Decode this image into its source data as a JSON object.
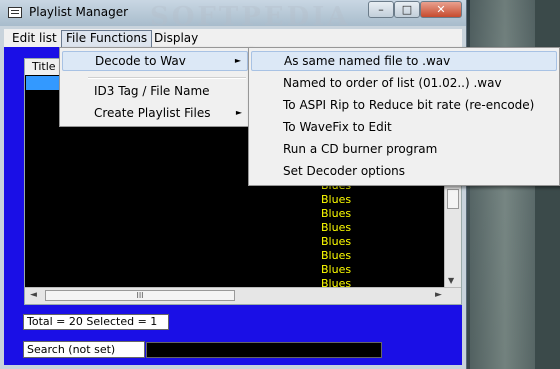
{
  "window": {
    "title": "Playlist Manager",
    "watermark": "SOFTPEDIA",
    "controls": {
      "minimize": "–",
      "maximize": "□",
      "close": "✕"
    }
  },
  "menubar": {
    "edit_list": "Edit list",
    "file_functions": "File Functions",
    "display": "Display"
  },
  "file_menu": {
    "items": [
      {
        "label": "Decode to Wav",
        "submenu": true,
        "highlighted": true
      },
      {
        "label": "ID3 Tag / File Name",
        "submenu": false
      },
      {
        "label": "Create Playlist Files",
        "submenu": true
      }
    ]
  },
  "decode_submenu": {
    "items": [
      {
        "label": "As same named file to .wav",
        "highlighted": true
      },
      {
        "label": "Named to order of list (01.02..) .wav"
      },
      {
        "label": "To ASPI Rip to Reduce bit rate (re-encode)"
      },
      {
        "label": "To WaveFix to Edit"
      },
      {
        "label": "Run a CD burner program"
      },
      {
        "label": "Set Decoder options"
      }
    ]
  },
  "list": {
    "column_header": "Title",
    "genres": [
      "Blues",
      "Blues",
      "Blues",
      "Blues",
      "Blues",
      "Blues",
      "Blues",
      "Blues"
    ]
  },
  "scrollbar": {
    "grip": "III"
  },
  "status": {
    "text": "Total =  20    Selected = 1"
  },
  "search": {
    "label": "Search (not set)",
    "value": ""
  },
  "colors": {
    "client_bg": "#1a0fe6",
    "genre_text": "#ffff00",
    "selection": "#3399ff"
  }
}
